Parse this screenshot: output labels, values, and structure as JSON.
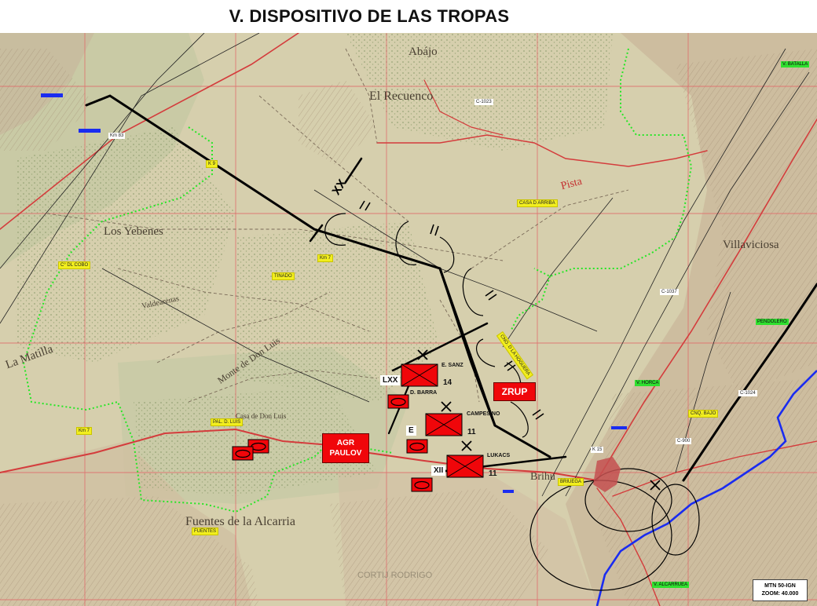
{
  "title": "V. DISPOSITIVO DE LAS TROPAS",
  "colors": {
    "map_bg": "#d6cfad",
    "forest": "#bdc6a1",
    "grid_red": "#e05858",
    "road_red": "#d43c3c",
    "river_blue": "#1a2cf0",
    "green_boundary": "#26e626",
    "unit_red": "#f0060a"
  },
  "place_names": {
    "abajo": "Abájo",
    "el_recuenco": "El Recuenco",
    "los_yebenes": "Los Yebenes",
    "la_matilla": "La Matilla",
    "valdearenas": "Valdearenas",
    "monte_don_luis": "Monte de Don Luis",
    "fuentes": "Fuentes de la Alcarria",
    "villaviciosa": "Villaviciosa",
    "brihuega": "Brihu",
    "pista": "Pista",
    "casa_don_luis": "Casa de Don Luis"
  },
  "map_tags": {
    "k8_7": "Km 7",
    "km83": "Km 83",
    "k9": "K 9",
    "k15": "K 15",
    "c_del_cobo": "C° DL COBO",
    "tinado": "TINADO",
    "casa_arriba": "CASA D ARRIBA",
    "c1023": "C-1023",
    "c1037": "C-1037",
    "c1024": "C-1024",
    "c900": "C-900",
    "cnq_bajo": "CNQ. BAJO",
    "cno_hoguera": "CNO. D LA HOGUERA",
    "pal_luis": "PAL. D. LUIS",
    "fuentes_tag": "FUENTES",
    "briuega_tag": "BRIUEGA",
    "v_batalla": "V. BATALLA",
    "v_horca": "V. HORCA",
    "penderero": "PENDOLERO",
    "v_alcarria": "V. ALCARRUEA",
    "cortijo": "CORTIJ RODRIGO"
  },
  "units": {
    "xx": "XX",
    "lxx": "LXX",
    "e": "E",
    "xii": "XII",
    "num14": "14",
    "num11a": "11",
    "num11b": "11",
    "e_sanz": "E. SANZ",
    "d_barra": "D. BARRA",
    "campesino": "CAMPESINO",
    "lukacs": "LUKACS",
    "zrup": "ZRUP",
    "agr_paulov": "AGR\nPAULOV"
  },
  "infobox": {
    "line1": "MTN 50-IGN",
    "line2": "ZOOM: 40.000"
  }
}
